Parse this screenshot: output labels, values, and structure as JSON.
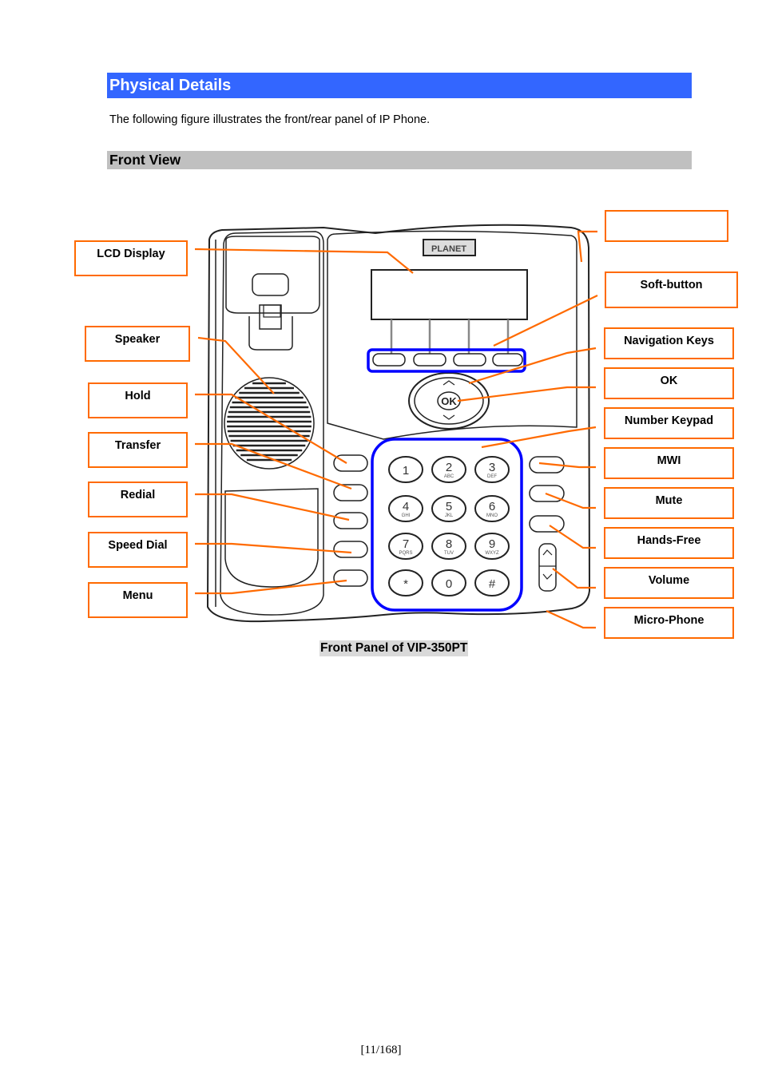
{
  "section": {
    "title": "Physical Details",
    "intro": "The following figure illustrates the front/rear panel of IP Phone."
  },
  "subsection": {
    "title": "Front View"
  },
  "figure": {
    "caption": "Front Panel of VIP-350PT",
    "brand_logo": "PLANET",
    "accent_colors": {
      "callout": "#ff6a00",
      "highlight": "#0000ff",
      "section_bar": "#3366ff",
      "subsection_bar": "#c0c0c0"
    },
    "labels_left": [
      "LCD Display",
      "Speaker",
      "Hold",
      "Transfer",
      "Redial",
      "Speed Dial",
      "Menu"
    ],
    "labels_right": [
      "",
      "Soft-button",
      "Navigation Keys",
      "OK",
      "Number Keypad",
      "MWI",
      "Mute",
      "Hands-Free",
      "Volume",
      "Micro-Phone"
    ],
    "keypad": [
      {
        "digit": "1",
        "letters": ""
      },
      {
        "digit": "2",
        "letters": "ABC"
      },
      {
        "digit": "3",
        "letters": "DEF"
      },
      {
        "digit": "4",
        "letters": "GHI"
      },
      {
        "digit": "5",
        "letters": "JKL"
      },
      {
        "digit": "6",
        "letters": "MNO"
      },
      {
        "digit": "7",
        "letters": "PQRS"
      },
      {
        "digit": "8",
        "letters": "TUV"
      },
      {
        "digit": "9",
        "letters": "WXYZ"
      },
      {
        "digit": "*",
        "letters": ""
      },
      {
        "digit": "0",
        "letters": ""
      },
      {
        "digit": "#",
        "letters": ""
      }
    ],
    "ok_key": "OK"
  },
  "footer": {
    "page_number": "[11/168]"
  }
}
